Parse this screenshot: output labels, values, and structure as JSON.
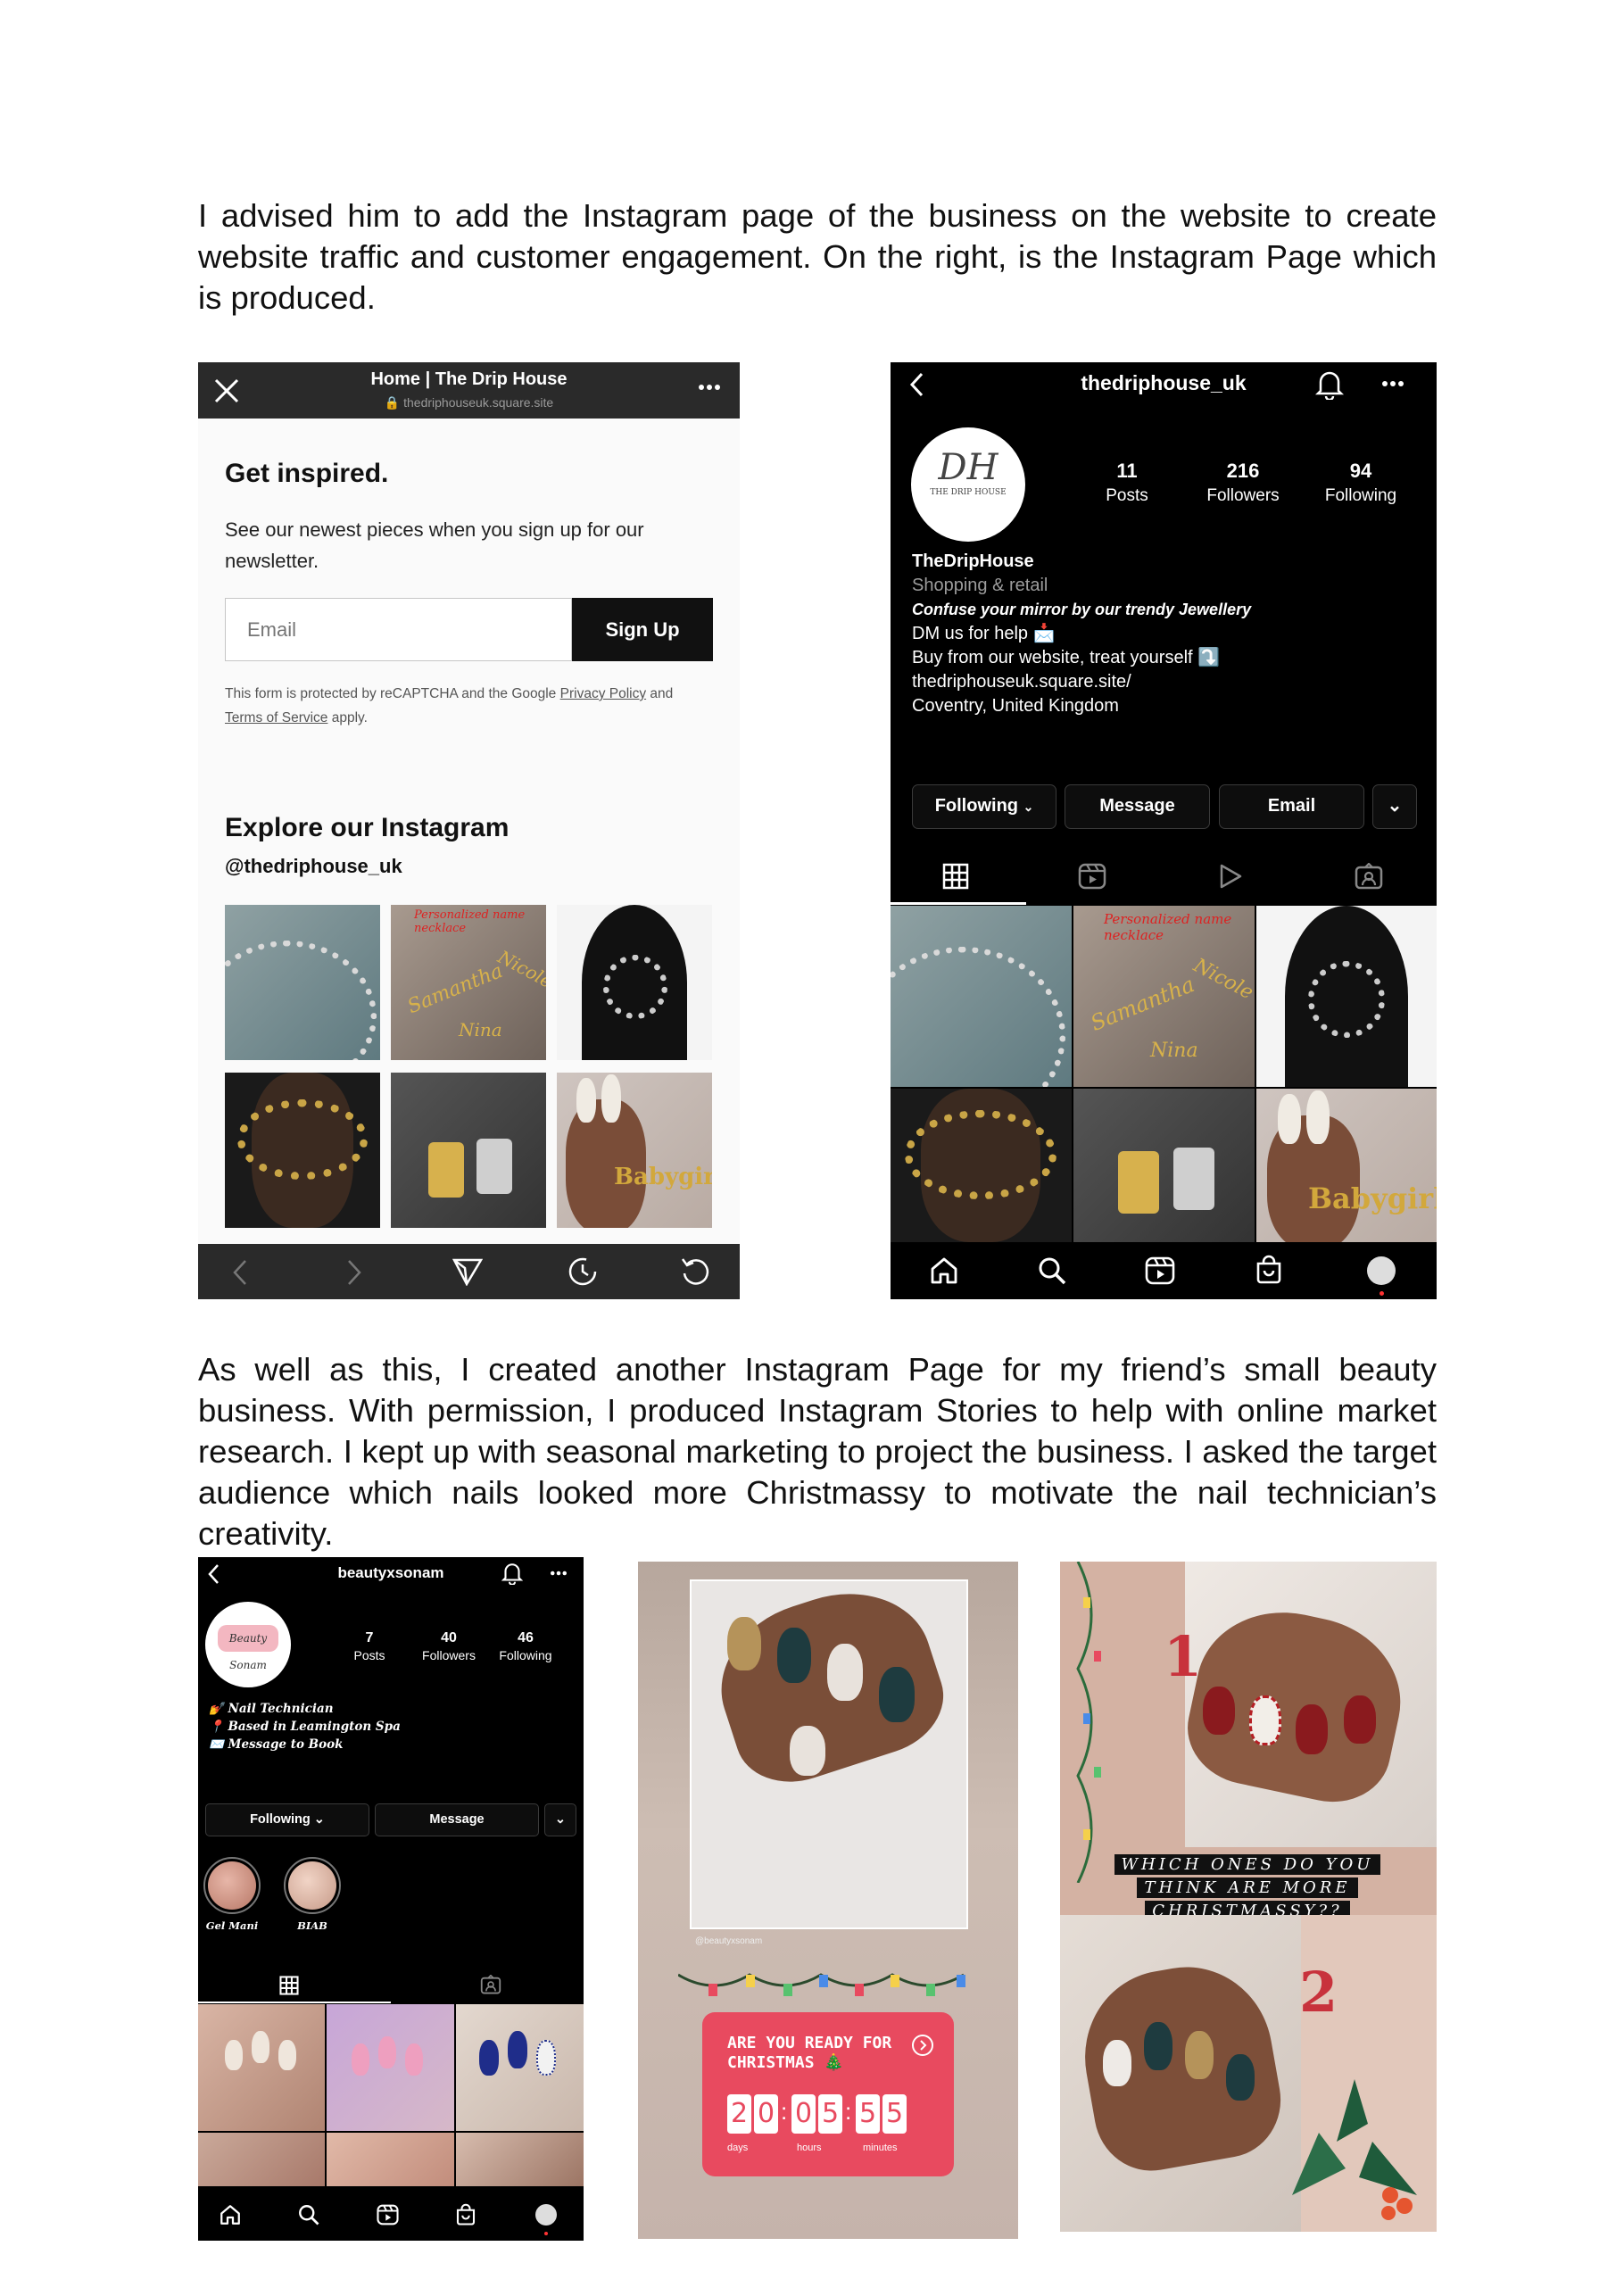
{
  "paragraphs": {
    "p1": "I advised him to add the Instagram page of the business on the website to create website traffic and customer engagement. On the right, is the Instagram Page which is produced.",
    "p2": "As well as this, I created another Instagram Page for my friend’s small beauty business. With permission, I produced Instagram Stories to help with online market research. I kept up with seasonal marketing to project the business. I asked the target audience which nails looked more Christmassy to motivate the nail technician’s creativity."
  },
  "website": {
    "title": "Home | The Drip House",
    "url": "thedriphouseuk.square.site",
    "heading": "Get inspired.",
    "subtext": "See our newest pieces when you sign up for our newsletter.",
    "email_placeholder": "Email",
    "signup_label": "Sign Up",
    "recaptcha_text": "This form is protected by reCAPTCHA and the Google ",
    "privacy_link": "Privacy Policy",
    "and_text": " and ",
    "terms_link": "Terms of Service",
    "apply_text": " apply.",
    "insta_heading": "Explore our Instagram",
    "insta_handle": "@thedriphouse_uk"
  },
  "insta_main": {
    "username": "thedriphouse_uk",
    "logo_text": "DH",
    "logo_sub": "THE DRIP HOUSE",
    "stats": [
      {
        "value": "11",
        "label": "Posts"
      },
      {
        "value": "216",
        "label": "Followers"
      },
      {
        "value": "94",
        "label": "Following"
      }
    ],
    "name": "TheDripHouse",
    "category": "Shopping & retail",
    "bio_tagline": "Confuse your mirror by our trendy Jewellery",
    "bio_line1": "DM us for help 📩",
    "bio_line2": "Buy from our website, treat yourself ⤵️",
    "link": "thedriphouseuk.square.site/",
    "location": "Coventry, United Kingdom",
    "buttons": {
      "following": "Following",
      "message": "Message",
      "email": "Email"
    }
  },
  "grid_overlays": {
    "necklace_banner": "Personalized name necklace",
    "name_samantha": "Samantha",
    "name_nina": "Nina",
    "name_nicole": "Nicole",
    "babygirl": "Babygirl"
  },
  "insta_beauty": {
    "username": "beautyxsonam",
    "logo_text": "Beauty Sonam",
    "stats": [
      {
        "value": "7",
        "label": "Posts"
      },
      {
        "value": "40",
        "label": "Followers"
      },
      {
        "value": "46",
        "label": "Following"
      }
    ],
    "bio": [
      "Nail Technician",
      "Based in Leamington Spa",
      "Message to Book"
    ],
    "buttons": {
      "following": "Following",
      "message": "Message"
    },
    "highlights": [
      "Gel Mani",
      "BIAB"
    ]
  },
  "story1": {
    "handle": "@beautyxsonam",
    "countdown_title": "ARE YOU READY FOR CHRISTMAS 🎄",
    "digits": [
      "2",
      "0",
      "0",
      "5",
      "5",
      "5"
    ],
    "units": [
      "days",
      "hours",
      "minutes"
    ]
  },
  "story2": {
    "number1": "1",
    "number2": "2",
    "question_lines": [
      "WHICH ONES DO YOU",
      "THINK ARE MORE",
      "CHRISTMASSY??"
    ]
  },
  "colors": {
    "countdown_red": "#e84a5f",
    "story_number_red": "#c8323c",
    "insta_black": "#000000"
  }
}
